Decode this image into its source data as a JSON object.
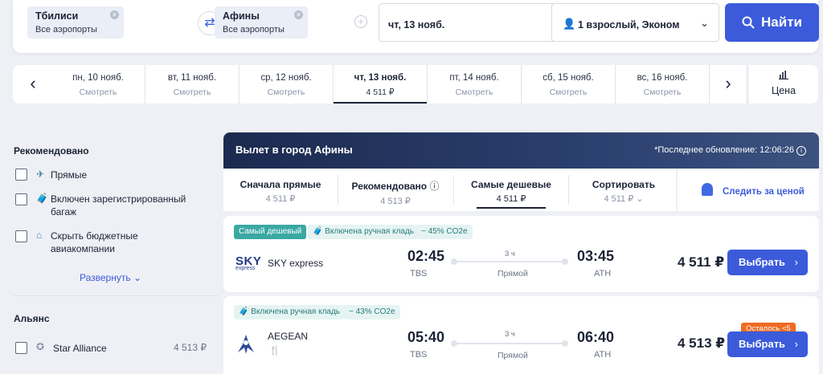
{
  "search": {
    "from_city": "Тбилиси",
    "from_airports": "Все аэропорты",
    "to_city": "Афины",
    "to_airports": "Все аэропорты",
    "date": "чт, 13 нояб.",
    "passengers": "1 взрослый, Эконом",
    "find_label": "Найти"
  },
  "dates": [
    {
      "day": "пн, 10 нояб.",
      "price": "Смотреть"
    },
    {
      "day": "вт, 11 нояб.",
      "price": "Смотреть"
    },
    {
      "day": "ср, 12 нояб.",
      "price": "Смотреть"
    },
    {
      "day": "чт, 13 нояб.",
      "price": "4 511 ₽"
    },
    {
      "day": "пт, 14 нояб.",
      "price": "Смотреть"
    },
    {
      "day": "сб, 15 нояб.",
      "price": "Смотреть"
    },
    {
      "day": "вс, 16 нояб.",
      "price": "Смотреть"
    }
  ],
  "price_toggle_label": "Цена",
  "sidebar": {
    "recommended_title": "Рекомендовано",
    "filters": [
      {
        "label_1": "Прямые",
        "label_2": ""
      },
      {
        "label_1": "Включен зарегистрированный",
        "label_2": "багаж"
      },
      {
        "label_1": "Скрыть бюджетные",
        "label_2": "авиакомпании"
      }
    ],
    "expand_label": "Развернуть",
    "alliance_title": "Альянс",
    "alliance": {
      "label": "Star Alliance",
      "price": "4 513 ₽"
    }
  },
  "results": {
    "title": "Вылет в город Афины",
    "updated": "*Последнее обновление: 12:06:26",
    "sort_tabs": [
      {
        "label": "Сначала прямые",
        "price": "4 511 ₽"
      },
      {
        "label": "Рекомендовано",
        "price": "4 513 ₽"
      },
      {
        "label": "Самые дешевые",
        "price": "4 511 ₽"
      },
      {
        "label": "Сортировать",
        "price": "4 511 ₽"
      }
    ],
    "follow_price": "Следить за ценой"
  },
  "flights": [
    {
      "tags": [
        "Самый дешевый",
        "Включена ручная кладь",
        "− 45% CO2e"
      ],
      "airline": "SKY express",
      "logo_text": "SKY",
      "logo_sub": "express",
      "dep_time": "02:45",
      "dep_code": "TBS",
      "arr_time": "03:45",
      "arr_code": "ATH",
      "duration": "3 ч",
      "stops": "Прямой",
      "price": "4 511 ₽",
      "button": "Выбрать",
      "badge": ""
    },
    {
      "tags": [
        "Включена ручная кладь",
        "− 43% CO2e"
      ],
      "airline": "AEGEAN",
      "dep_time": "05:40",
      "dep_code": "TBS",
      "arr_time": "06:40",
      "arr_code": "ATH",
      "duration": "3 ч",
      "stops": "Прямой",
      "price": "4 513 ₽",
      "button": "Выбрать",
      "badge": "Осталось <5"
    }
  ],
  "colors": {
    "accent": "#3b5bdb",
    "header": "#1b2a4f",
    "teal": "#3aa8a3",
    "orange": "#f06a22"
  }
}
